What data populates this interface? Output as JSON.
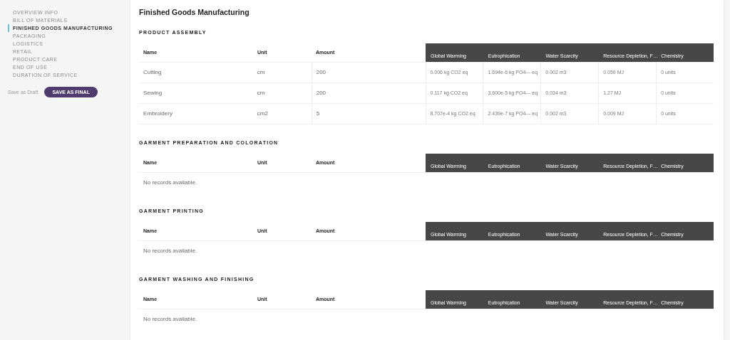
{
  "sidebar": {
    "items": [
      {
        "label": "OVERVIEW INFO",
        "selected": false
      },
      {
        "label": "BILL OF MATERIALS",
        "selected": false
      },
      {
        "label": "FINISHED GOODS MANUFACTURING",
        "selected": true
      },
      {
        "label": "PACKAGING",
        "selected": false
      },
      {
        "label": "LOGISTICS",
        "selected": false
      },
      {
        "label": "RETAIL",
        "selected": false
      },
      {
        "label": "PRODUCT CARE",
        "selected": false
      },
      {
        "label": "END OF USE",
        "selected": false
      },
      {
        "label": "DURATION OF SERVICE",
        "selected": false
      }
    ],
    "save_draft": "Save as Draft",
    "save_final": "SAVE AS FINAL"
  },
  "page_title": "Finished Goods Manufacturing",
  "sections": [
    {
      "title": "PRODUCT ASSEMBLY",
      "columns": [
        "Name",
        "Unit",
        "Amount"
      ],
      "impact_columns": [
        "Global Warming",
        "Eutrophication",
        "Water Scarcity",
        "Resource Depletion, F…",
        "Chemistry"
      ],
      "rows": [
        {
          "cells": [
            "Cutting",
            "cm",
            "200"
          ],
          "impacts": [
            "0.006 kg CO2 eq",
            "1.694e-6 kg PO4--- eq",
            "0.002 m3",
            "0.059 MJ",
            "0 units"
          ]
        },
        {
          "cells": [
            "Sewing",
            "cm",
            "200"
          ],
          "impacts": [
            "0.117 kg CO2 eq",
            "3.600e-5 kg PO4--- eq",
            "0.034 m3",
            "1.27 MJ",
            "0 units"
          ]
        },
        {
          "cells": [
            "Embroidery",
            "cm2",
            "5"
          ],
          "impacts": [
            "8.707e-4 kg CO2 eq",
            "2.439e-7 kg PO4--- eq",
            "0.002 m3",
            "0.009 MJ",
            "0 units"
          ]
        }
      ]
    },
    {
      "title": "GARMENT PREPARATION AND COLORATION",
      "columns": [
        "Name",
        "Unit",
        "Amount"
      ],
      "impact_columns": [
        "Global Warming",
        "Eutrophication",
        "Water Scarcity",
        "Resource Depletion, F…",
        "Chemistry"
      ],
      "empty_message": "No records available."
    },
    {
      "title": "GARMENT PRINTING",
      "columns": [
        "Name",
        "Unit",
        "Amount"
      ],
      "impact_columns": [
        "Global Warming",
        "Eutrophication",
        "Water Scarcity",
        "Resource Depletion, F…",
        "Chemistry"
      ],
      "empty_message": "No records available."
    },
    {
      "title": "GARMENT WASHING AND FINISHING",
      "columns": [
        "Name",
        "Unit",
        "Amount"
      ],
      "impact_columns": [
        "Global Warming",
        "Eutrophication",
        "Water Scarcity",
        "Resource Depletion, F…",
        "Chemistry"
      ],
      "empty_message": "No records available."
    }
  ]
}
